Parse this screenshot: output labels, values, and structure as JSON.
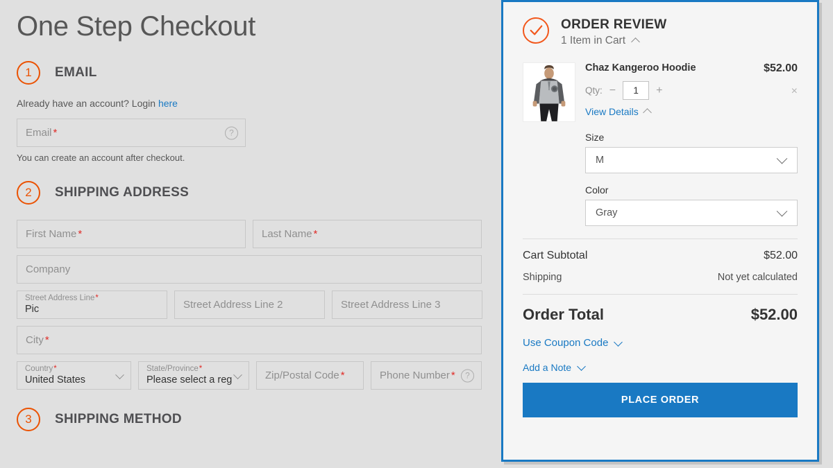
{
  "page": {
    "title": "One Step Checkout"
  },
  "steps": {
    "email": {
      "number": "1",
      "title": "EMAIL",
      "login_prompt": "Already have an account? Login ",
      "login_link": "here",
      "email_placeholder": "Email",
      "required_mark": "*",
      "help_icon": "question-mark-icon",
      "hint": "You can create an account after checkout."
    },
    "shipping_address": {
      "number": "2",
      "title": "SHIPPING ADDRESS",
      "fields": {
        "first_name": {
          "label": "First Name",
          "value": "",
          "required": "*"
        },
        "last_name": {
          "label": "Last Name",
          "value": "",
          "required": "*"
        },
        "company": {
          "label": "Company",
          "value": "",
          "required": ""
        },
        "street1": {
          "label": "Street Address Line",
          "value": "Pic",
          "required": "*"
        },
        "street2": {
          "label": "Street Address Line 2",
          "value": "",
          "required": ""
        },
        "street3": {
          "label": "Street Address Line 3",
          "value": "",
          "required": ""
        },
        "city": {
          "label": "City",
          "value": "",
          "required": "*"
        },
        "country": {
          "label": "Country",
          "value": "United States",
          "required": "*"
        },
        "state": {
          "label": "State/Province",
          "value": "Please select a reg",
          "required": "*"
        },
        "zip": {
          "label": "Zip/Postal Code",
          "value": "",
          "required": "*"
        },
        "phone": {
          "label": "Phone Number",
          "value": "",
          "required": "*"
        }
      }
    },
    "shipping_method": {
      "number": "3",
      "title": "SHIPPING METHOD"
    }
  },
  "order_review": {
    "title": "ORDER REVIEW",
    "subtitle": "1 Item in Cart",
    "status_icon": "check-circle-icon",
    "product": {
      "name": "Chaz Kangeroo Hoodie",
      "price": "$52.00",
      "qty_label": "Qty:",
      "qty_value": "1",
      "qty_minus": "−",
      "qty_plus": "+",
      "remove_label": "×",
      "view_details": "View Details",
      "options": [
        {
          "label": "Size",
          "value": "M"
        },
        {
          "label": "Color",
          "value": "Gray"
        }
      ]
    },
    "totals": [
      {
        "label": "Cart Subtotal",
        "value": "$52.00"
      },
      {
        "label": "Shipping",
        "value": "Not yet calculated"
      }
    ],
    "grand_total": {
      "label": "Order Total",
      "value": "$52.00"
    },
    "coupon_link": "Use Coupon Code",
    "note_link": "Add a Note",
    "place_order_label": "PLACE ORDER"
  },
  "colors": {
    "accent_orange": "#eb5202",
    "link_blue": "#1979c3",
    "panel_border": "#1979c3",
    "required_red": "#e02b27",
    "page_bg": "#e0e0e0",
    "panel_bg": "#f5f5f5"
  }
}
